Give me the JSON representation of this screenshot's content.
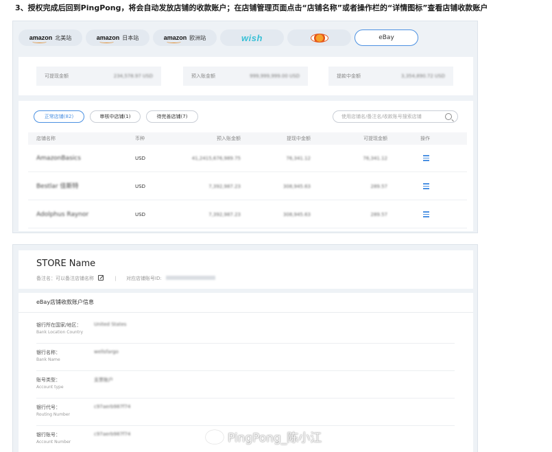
{
  "instruction": "3、授权完成后回到PingPong，将会自动发放店铺的收款账户；在店铺管理页面点击“店铺名称”或者操作栏的“详情图标”查看店铺收款账户",
  "platforms": [
    {
      "brand": "amazon",
      "label": "北美站",
      "active": false
    },
    {
      "brand": "amazon",
      "label": "日本站",
      "active": false
    },
    {
      "brand": "amazon",
      "label": "欧洲站",
      "active": false
    },
    {
      "brand": "wish",
      "label": "",
      "active": false
    },
    {
      "brand": "newegg",
      "label": "",
      "active": false
    },
    {
      "brand": "",
      "label": "eBay",
      "active": true
    }
  ],
  "stats": [
    {
      "label": "可提现金额",
      "value": "234,578.97 USD"
    },
    {
      "label": "预入账金额",
      "value": "999,999,999.00 USD"
    },
    {
      "label": "提款中金额",
      "value": "3,354,890.72 USD"
    }
  ],
  "status_tabs": [
    {
      "label": "正常店铺(82)",
      "active": true
    },
    {
      "label": "审核中店铺(1)",
      "active": false
    },
    {
      "label": "待完善店铺(7)",
      "active": false
    }
  ],
  "search_placeholder": "使用店铺名/备注名/收款账号搜索店铺",
  "table": {
    "headers": [
      "店铺名称",
      "币种",
      "预入账金额",
      "提现中金额",
      "可提现金额",
      "操作"
    ],
    "rows": [
      {
        "name": "AmazonBasics",
        "currency": "USD",
        "pending": "41,2415,676,989.75",
        "withdrawing": "76,341.12",
        "available": "76,341.12"
      },
      {
        "name": "Bestlar 佳斯特",
        "currency": "USD",
        "pending": "7,392,987.23",
        "withdrawing": "308,945.63",
        "available": "289.57"
      },
      {
        "name": "Adolphus Raynor",
        "currency": "USD",
        "pending": "7,392,987.23",
        "withdrawing": "308,945.63",
        "available": "289.57"
      }
    ]
  },
  "store_detail": {
    "title": "STORE Name",
    "remark_label": "备注名：可以备注店铺名称",
    "platform_id_label": "对应店铺账号ID:"
  },
  "account": {
    "title": "eBay店铺收款账户信息",
    "fields": [
      {
        "label": "银行所在国家/地区：",
        "sub": "Bank Location Country",
        "value": "United States"
      },
      {
        "label": "银行名称：",
        "sub": "Bank Name",
        "value": "wellsfargo"
      },
      {
        "label": "账号类型：",
        "sub": "Account type",
        "value": "支票账户"
      },
      {
        "label": "银行代号：",
        "sub": "Routing Number",
        "value": "c97aerb987f74"
      },
      {
        "label": "银行账号：",
        "sub": "Account Number",
        "value": "c97aerb987f74"
      }
    ]
  },
  "watermark": "PingPong_陈小江"
}
